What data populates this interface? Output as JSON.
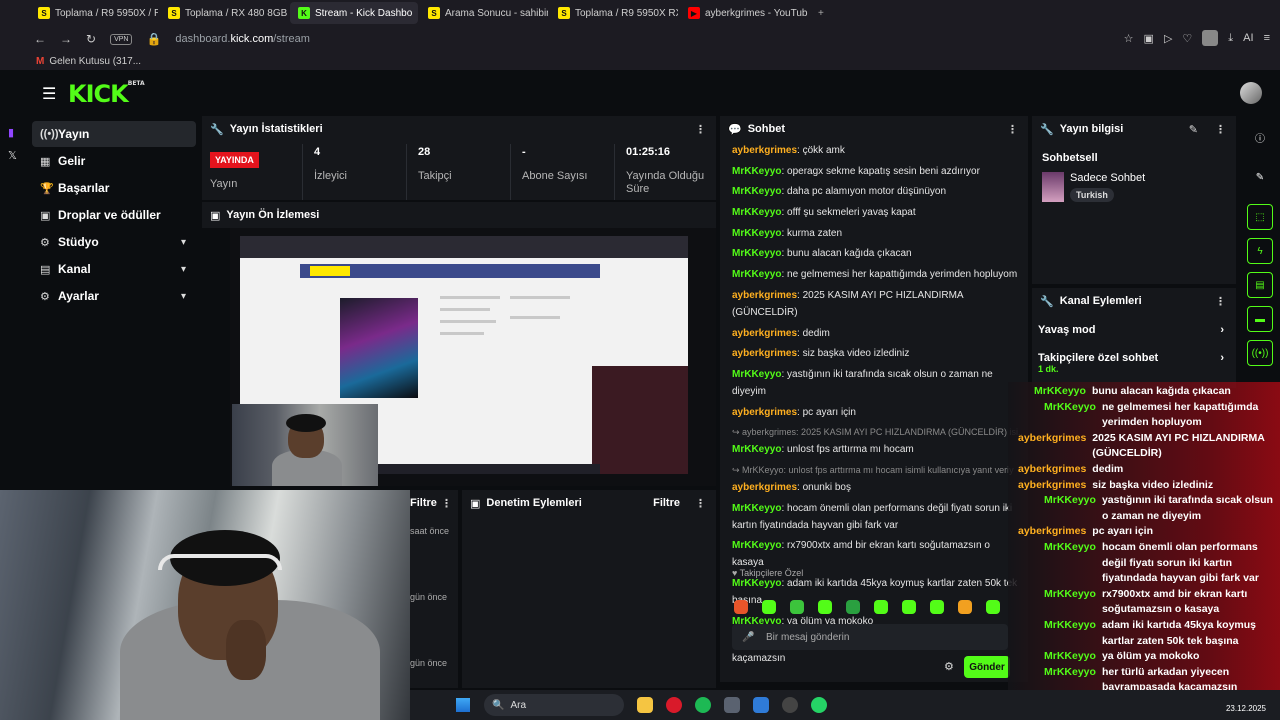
{
  "browser": {
    "tabs": [
      {
        "label": "Toplama / R9 5950X / RTX",
        "icon_color": "#ffe800",
        "icon_text": "S"
      },
      {
        "label": "Toplama / RX 480 8GB Ni",
        "icon_color": "#ffe800",
        "icon_text": "S"
      },
      {
        "label": "Stream - Kick Dashbo",
        "icon_color": "#53fc18",
        "icon_text": "K",
        "active": true
      },
      {
        "label": "Arama Sonucu - sahibinde",
        "icon_color": "#ffe800",
        "icon_text": "S"
      },
      {
        "label": "Toplama / R9 5950X RX79",
        "icon_color": "#ffe800",
        "icon_text": "S"
      },
      {
        "label": "ayberkgrimes - YouTube",
        "icon_color": "#ff0000",
        "icon_text": "▶"
      }
    ],
    "new_tab_icon": "+",
    "vpn_label": "VPN",
    "url_prefix": "dashboard.",
    "url_domain": "kick.com",
    "url_path": "/stream",
    "bookmark": "Gelen Kutusu (317...",
    "ai_label": "AI"
  },
  "kick": {
    "logo": "KICK",
    "logo_badge": "BETA"
  },
  "sidebar": {
    "items": [
      {
        "label": "Yayın",
        "icon": "broadcast-icon",
        "glyph": "((•))",
        "active": true
      },
      {
        "label": "Gelir",
        "icon": "revenue-icon",
        "glyph": "▦"
      },
      {
        "label": "Başarılar",
        "icon": "trophy-icon",
        "glyph": "🏆"
      },
      {
        "label": "Droplar ve ödüller",
        "icon": "drops-icon",
        "glyph": "▣"
      },
      {
        "label": "Stüdyo",
        "icon": "studio-icon",
        "glyph": "⚙",
        "chevron": true
      },
      {
        "label": "Kanal",
        "icon": "channel-icon",
        "glyph": "▤",
        "chevron": true
      },
      {
        "label": "Ayarlar",
        "icon": "settings-icon",
        "glyph": "⚙",
        "chevron": true
      }
    ]
  },
  "stats": {
    "title": "Yayın İstatistikleri",
    "live_badge": "YAYINDA",
    "live_label": "Yayın",
    "viewers_value": "4",
    "viewers_label": "İzleyici",
    "followers_value": "28",
    "followers_label": "Takipçi",
    "subs_value": "-",
    "subs_label": "Abone Sayısı",
    "duration_value": "01:25:16",
    "duration_label": "Yayında Olduğu Süre"
  },
  "preview": {
    "title": "Yayın Ön İzlemesi"
  },
  "chat": {
    "title": "Sohbet",
    "messages": [
      {
        "user": "ayberkgrimes",
        "role": "host",
        "text": "çökk amk"
      },
      {
        "user": "MrKKeyyo",
        "role": "viewer",
        "text": "operagx sekme kapatış sesin beni azdırıyor"
      },
      {
        "user": "MrKKeyyo",
        "role": "viewer",
        "text": "daha pc alamıyon motor düşünüyon"
      },
      {
        "user": "MrKKeyyo",
        "role": "viewer",
        "text": "offf şu sekmeleri yavaş kapat"
      },
      {
        "user": "MrKKeyyo",
        "role": "viewer",
        "text": "kurma zaten"
      },
      {
        "user": "MrKKeyyo",
        "role": "viewer",
        "text": "bunu alacan kağıda çıkacan"
      },
      {
        "user": "MrKKeyyo",
        "role": "viewer",
        "text": "ne gelmemesi her kapattığımda yerimden hopluyom"
      },
      {
        "user": "ayberkgrimes",
        "role": "host",
        "text": "2025 KASIM AYI PC HIZLANDIRMA (GÜNCELDİR)"
      },
      {
        "user": "ayberkgrimes",
        "role": "host",
        "text": "dedim"
      },
      {
        "user": "ayberkgrimes",
        "role": "host",
        "text": "siz başka video izlediniz"
      },
      {
        "user": "MrKKeyyo",
        "role": "viewer",
        "text": "yastığının iki tarafında sıcak olsun o zaman ne diyeyim"
      },
      {
        "user": "ayberkgrimes",
        "role": "host",
        "text": "pc ayarı için"
      }
    ],
    "reply1_context": "↪ ayberkgrimes: 2025 KASIM AYI PC HIZLANDIRMA (GÜNCELDİR) isi...",
    "reply1_user": "MrKKeyyo",
    "reply1_text": "unlost fps arttırma mı hocam",
    "reply2_context": "↪ MrKKeyyo: unlost fps arttırma mı hocam isimli kullanıcıya yanıt veriy",
    "reply2_user": "ayberkgrimes",
    "reply2_text": "onunki boş",
    "messages2": [
      {
        "user": "MrKKeyyo",
        "role": "viewer",
        "text": "hocam önemli olan performans değil fiyatı sorun iki kartın fiyatındada hayvan gibi fark var"
      },
      {
        "user": "MrKKeyyo",
        "role": "viewer",
        "text": "rx7900xtx amd bir ekran kartı soğutamazsın o kasaya"
      },
      {
        "user": "MrKKeyyo",
        "role": "viewer",
        "text": "adam iki kartıda 45kya koymuş kartlar zaten 50k tek başına"
      },
      {
        "user": "MrKKeyyo",
        "role": "viewer",
        "text": "ya ölüm ya mokoko"
      },
      {
        "user": "MrKKeyyo",
        "role": "viewer",
        "text": "her türlü arkadan yiyecen bayrampaşada kaçamazsın"
      }
    ],
    "followers_only": "♥ Takipçilere Özel",
    "input_placeholder": "Bir mesaj gönderin",
    "send_label": "Gönder",
    "user_colors": {
      "host": "#ffb020",
      "viewer": "#53fc18"
    }
  },
  "info": {
    "title": "Yayın bilgisi",
    "section": "Sohbetsell",
    "stream_title": "Sadece Sohbet",
    "language": "Turkish"
  },
  "channel_actions": {
    "title": "Kanal Eylemleri",
    "slow_mode": "Yavaş mod",
    "followers_chat": "Takipçilere özel sohbet",
    "followers_chat_value": "1 dk."
  },
  "lower": {
    "filter_label": "Filtre",
    "times": [
      "saat önce",
      "gün önce",
      "gün önce"
    ],
    "mod_title": "Denetim Eylemleri",
    "mod_filter": "Filtre"
  },
  "overlay": {
    "messages": [
      {
        "user": "MrKKeyyo",
        "role": "viewer",
        "text": "bunu alacan kağıda çıkacan"
      },
      {
        "user": "MrKKeyyo",
        "role": "viewer",
        "text": "ne gelmemesi her kapattığımda yerimden hopluyom"
      },
      {
        "user": "ayberkgrimes",
        "role": "host",
        "text": "2025 KASIM AYI PC HIZLANDIRMA (GÜNCELDİR)"
      },
      {
        "user": "ayberkgrimes",
        "role": "host",
        "text": "dedim"
      },
      {
        "user": "ayberkgrimes",
        "role": "host",
        "text": "siz başka video izlediniz"
      },
      {
        "user": "MrKKeyyo",
        "role": "viewer",
        "text": "yastığının iki tarafında sıcak olsun o zaman ne diyeyim"
      },
      {
        "user": "ayberkgrimes",
        "role": "host",
        "text": "pc ayarı için"
      },
      {
        "user": "MrKKeyyo",
        "role": "viewer",
        "text": "hocam önemli olan performans değil fiyatı sorun iki kartın fiyatındada hayvan gibi fark var"
      },
      {
        "user": "MrKKeyyo",
        "role": "viewer",
        "text": "rx7900xtx amd bir ekran kartı soğutamazsın o kasaya"
      },
      {
        "user": "MrKKeyyo",
        "role": "viewer",
        "text": "adam iki kartıda 45kya koymuş kartlar zaten 50k tek başına"
      },
      {
        "user": "MrKKeyyo",
        "role": "viewer",
        "text": "ya ölüm ya mokoko"
      },
      {
        "user": "MrKKeyyo",
        "role": "viewer",
        "text": "her türlü arkadan yiyecen bayrampaşada kaçamazsın"
      }
    ]
  },
  "taskbar": {
    "search_label": "Ara",
    "date": "23.12.2025"
  },
  "colors": {
    "brand": "#53fc18",
    "live": "#e4141d",
    "host": "#ffb020"
  }
}
